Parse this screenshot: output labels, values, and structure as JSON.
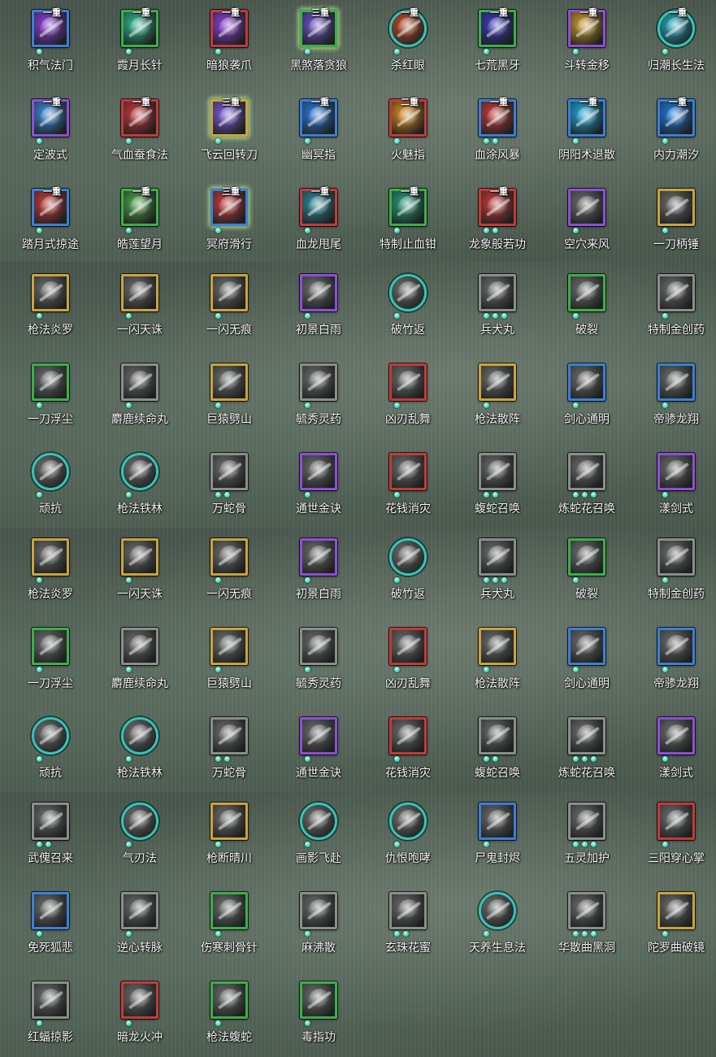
{
  "colors": {
    "purple": "#8e4fd6",
    "green": "#3cae4a",
    "red": "#c33a3a",
    "blue": "#3b7fd8",
    "gold": "#c9a33e",
    "teal": "#33c5b6",
    "gray": "#8a8f8c"
  },
  "rows": [
    [
      {
        "label": "积气法门",
        "badge": "一重",
        "frame": "#3b7fd8",
        "art": "#8a3fd8",
        "dots": 1,
        "icon": "skill-icon"
      },
      {
        "label": "霞月长针",
        "badge": "一重",
        "frame": "#3cae4a",
        "art": "#2fb58e",
        "dots": 1,
        "icon": "skill-icon"
      },
      {
        "label": "暗狼袭爪",
        "badge": "一重",
        "frame": "#c33a3a",
        "art": "#8a3fd8",
        "dots": 1,
        "icon": "skill-icon"
      },
      {
        "label": "黑煞落贪狼",
        "badge": "三重",
        "frame": "#3cae4a",
        "art": "#6a4fc8",
        "dots": 1,
        "glow": true,
        "icon": "skill-icon"
      },
      {
        "label": "杀红眼",
        "badge": "一重",
        "frame": "#33c5b6",
        "art": "#b84a2a",
        "dots": 1,
        "round": true,
        "icon": "skill-icon"
      },
      {
        "label": "七荒黑牙",
        "badge": "一重",
        "frame": "#3cae4a",
        "art": "#3a3ab8",
        "dots": 1,
        "icon": "skill-icon"
      },
      {
        "label": "斗转金移",
        "badge": "一重",
        "frame": "#8e4fd6",
        "art": "#c99a2e",
        "dots": 1,
        "icon": "skill-icon"
      },
      {
        "label": "归潮长生法",
        "badge": "一重",
        "frame": "#33c5b6",
        "art": "#1fa6b8",
        "dots": 1,
        "round": true,
        "icon": "skill-icon"
      }
    ],
    [
      {
        "label": "定波式",
        "badge": "一重",
        "frame": "#8e4fd6",
        "art": "#3a8ad8",
        "dots": 1,
        "icon": "skill-icon"
      },
      {
        "label": "气血蚕食法",
        "badge": "一重",
        "frame": "#c33a3a",
        "art": "#c33a3a",
        "dots": 1,
        "icon": "skill-icon"
      },
      {
        "label": "飞云回转刀",
        "badge": "三重",
        "frame": "#c9a33e",
        "art": "#7a5ad8",
        "dots": 1,
        "glow": true,
        "icon": "skill-icon"
      },
      {
        "label": "幽冥指",
        "badge": "一重",
        "frame": "#3b7fd8",
        "art": "#2a7ad8",
        "dots": 1,
        "icon": "skill-icon"
      },
      {
        "label": "火魅指",
        "badge": "二重",
        "frame": "#c33a3a",
        "art": "#d88a1e",
        "dots": 1,
        "icon": "skill-icon"
      },
      {
        "label": "血涂风暴",
        "badge": "一重",
        "frame": "#3b7fd8",
        "art": "#c33a3a",
        "dots": 2,
        "icon": "skill-icon"
      },
      {
        "label": "阴阳术退散",
        "badge": "一重",
        "frame": "#3b7fd8",
        "art": "#1fa6d8",
        "dots": 1,
        "icon": "skill-icon"
      },
      {
        "label": "内力潮汐",
        "badge": "一重",
        "frame": "#3b7fd8",
        "art": "#1f7ad8",
        "dots": 1,
        "icon": "skill-icon"
      }
    ],
    [
      {
        "label": "踏月式掠途",
        "badge": "一重",
        "frame": "#3b7fd8",
        "art": "#c33a3a",
        "dots": 1,
        "icon": "skill-icon"
      },
      {
        "label": "皓莲望月",
        "badge": "一重",
        "frame": "#3cae4a",
        "art": "#4aa04a",
        "dots": 1,
        "icon": "skill-icon"
      },
      {
        "label": "冥府滑行",
        "badge": "三重",
        "frame": "#3b7fd8",
        "art": "#c33a3a",
        "dots": 1,
        "glow": true,
        "icon": "skill-icon"
      },
      {
        "label": "血龙甩尾",
        "badge": "一重",
        "frame": "#c33a3a",
        "art": "#2a8a9a",
        "dots": 1,
        "icon": "skill-icon"
      },
      {
        "label": "特制止血钳",
        "badge": "一重",
        "frame": "#3cae4a",
        "art": "#2a9a7a",
        "dots": 1,
        "icon": "skill-icon"
      },
      {
        "label": "龙象般若功",
        "badge": "一重",
        "frame": "#c33a3a",
        "art": "#c33a3a",
        "dots": 2,
        "icon": "skill-icon"
      },
      {
        "label": "空穴来风",
        "badge": "",
        "frame": "#8e4fd6",
        "art": "#6a6d6b",
        "dots": 1,
        "icon": "skill-icon"
      },
      {
        "label": "一刀柄锤",
        "badge": "",
        "frame": "#c9a33e",
        "art": "#6a6d6b",
        "dots": 1,
        "icon": "skill-icon"
      }
    ],
    [
      {
        "label": "枪法炎罗",
        "badge": "",
        "frame": "#c9a33e",
        "art": "#6a6d6b",
        "dots": 1,
        "icon": "skill-icon"
      },
      {
        "label": "一闪天诛",
        "badge": "",
        "frame": "#c9a33e",
        "art": "#6a6d6b",
        "dots": 1,
        "icon": "skill-icon"
      },
      {
        "label": "一闪无痕",
        "badge": "",
        "frame": "#c9a33e",
        "art": "#6a6d6b",
        "dots": 1,
        "icon": "skill-icon"
      },
      {
        "label": "初景白雨",
        "badge": "",
        "frame": "#8e4fd6",
        "art": "#6a6d6b",
        "dots": 1,
        "icon": "skill-icon"
      },
      {
        "label": "破竹返",
        "badge": "",
        "frame": "#33c5b6",
        "art": "#6a6d6b",
        "dots": 1,
        "round": true,
        "icon": "skill-icon"
      },
      {
        "label": "兵犬丸",
        "badge": "",
        "frame": "#8a8f8c",
        "art": "#6a6d6b",
        "dots": 3,
        "icon": "skill-icon"
      },
      {
        "label": "破裂",
        "badge": "",
        "frame": "#3cae4a",
        "art": "#6a6d6b",
        "dots": 1,
        "icon": "skill-icon"
      },
      {
        "label": "特制金创药",
        "badge": "",
        "frame": "#8a8f8c",
        "art": "#6a6d6b",
        "dots": 1,
        "icon": "skill-icon"
      }
    ],
    [
      {
        "label": "一刀浮尘",
        "badge": "",
        "frame": "#3cae4a",
        "art": "#6a6d6b",
        "dots": 1,
        "icon": "skill-icon"
      },
      {
        "label": "麝鹿续命丸",
        "badge": "",
        "frame": "#8a8f8c",
        "art": "#6a6d6b",
        "dots": 1,
        "icon": "skill-icon"
      },
      {
        "label": "巨猿劈山",
        "badge": "",
        "frame": "#c9a33e",
        "art": "#6a6d6b",
        "dots": 1,
        "icon": "skill-icon"
      },
      {
        "label": "毓秀灵药",
        "badge": "",
        "frame": "#8a8f8c",
        "art": "#6a6d6b",
        "dots": 1,
        "icon": "skill-icon"
      },
      {
        "label": "凶刃乱舞",
        "badge": "",
        "frame": "#c33a3a",
        "art": "#6a6d6b",
        "dots": 1,
        "icon": "skill-icon"
      },
      {
        "label": "枪法散阵",
        "badge": "",
        "frame": "#c9a33e",
        "art": "#6a6d6b",
        "dots": 1,
        "icon": "skill-icon"
      },
      {
        "label": "剑心通明",
        "badge": "",
        "frame": "#3b7fd8",
        "art": "#6a6d6b",
        "dots": 1,
        "icon": "skill-icon"
      },
      {
        "label": "帝骖龙翔",
        "badge": "",
        "frame": "#3b7fd8",
        "art": "#6a6d6b",
        "dots": 1,
        "icon": "skill-icon"
      }
    ],
    [
      {
        "label": "顽抗",
        "badge": "",
        "frame": "#33c5b6",
        "art": "#6a6d6b",
        "dots": 1,
        "round": true,
        "icon": "skill-icon"
      },
      {
        "label": "枪法铁林",
        "badge": "",
        "frame": "#33c5b6",
        "art": "#6a6d6b",
        "dots": 1,
        "round": true,
        "icon": "skill-icon"
      },
      {
        "label": "万蛇骨",
        "badge": "",
        "frame": "#8a8f8c",
        "art": "#6a6d6b",
        "dots": 2,
        "icon": "skill-icon"
      },
      {
        "label": "通世金诀",
        "badge": "",
        "frame": "#8e4fd6",
        "art": "#6a6d6b",
        "dots": 1,
        "icon": "skill-icon"
      },
      {
        "label": "花钱消灾",
        "badge": "",
        "frame": "#c33a3a",
        "art": "#6a6d6b",
        "dots": 1,
        "icon": "skill-icon"
      },
      {
        "label": "蝮蛇召唤",
        "badge": "",
        "frame": "#8a8f8c",
        "art": "#6a6d6b",
        "dots": 2,
        "icon": "skill-icon"
      },
      {
        "label": "炼蛇花召唤",
        "badge": "",
        "frame": "#8a8f8c",
        "art": "#6a6d6b",
        "dots": 3,
        "icon": "skill-icon"
      },
      {
        "label": "漾剑式",
        "badge": "",
        "frame": "#8e4fd6",
        "art": "#6a6d6b",
        "dots": 1,
        "icon": "skill-icon"
      }
    ],
    [
      {
        "label": "枪法炎罗",
        "badge": "",
        "frame": "#c9a33e",
        "art": "#6a6d6b",
        "dots": 1,
        "icon": "skill-icon"
      },
      {
        "label": "一闪天诛",
        "badge": "",
        "frame": "#c9a33e",
        "art": "#6a6d6b",
        "dots": 1,
        "icon": "skill-icon"
      },
      {
        "label": "一闪无痕",
        "badge": "",
        "frame": "#c9a33e",
        "art": "#6a6d6b",
        "dots": 1,
        "icon": "skill-icon"
      },
      {
        "label": "初景白雨",
        "badge": "",
        "frame": "#8e4fd6",
        "art": "#6a6d6b",
        "dots": 1,
        "icon": "skill-icon"
      },
      {
        "label": "破竹返",
        "badge": "",
        "frame": "#33c5b6",
        "art": "#6a6d6b",
        "dots": 1,
        "round": true,
        "icon": "skill-icon"
      },
      {
        "label": "兵犬丸",
        "badge": "",
        "frame": "#8a8f8c",
        "art": "#6a6d6b",
        "dots": 3,
        "icon": "skill-icon"
      },
      {
        "label": "破裂",
        "badge": "",
        "frame": "#3cae4a",
        "art": "#6a6d6b",
        "dots": 1,
        "icon": "skill-icon"
      },
      {
        "label": "特制金创药",
        "badge": "",
        "frame": "#8a8f8c",
        "art": "#6a6d6b",
        "dots": 1,
        "icon": "skill-icon"
      }
    ],
    [
      {
        "label": "一刀浮尘",
        "badge": "",
        "frame": "#3cae4a",
        "art": "#6a6d6b",
        "dots": 1,
        "icon": "skill-icon"
      },
      {
        "label": "麝鹿续命丸",
        "badge": "",
        "frame": "#8a8f8c",
        "art": "#6a6d6b",
        "dots": 1,
        "icon": "skill-icon"
      },
      {
        "label": "巨猿劈山",
        "badge": "",
        "frame": "#c9a33e",
        "art": "#6a6d6b",
        "dots": 1,
        "icon": "skill-icon"
      },
      {
        "label": "毓秀灵药",
        "badge": "",
        "frame": "#8a8f8c",
        "art": "#6a6d6b",
        "dots": 1,
        "icon": "skill-icon"
      },
      {
        "label": "凶刃乱舞",
        "badge": "",
        "frame": "#c33a3a",
        "art": "#6a6d6b",
        "dots": 1,
        "icon": "skill-icon"
      },
      {
        "label": "枪法散阵",
        "badge": "",
        "frame": "#c9a33e",
        "art": "#6a6d6b",
        "dots": 1,
        "icon": "skill-icon"
      },
      {
        "label": "剑心通明",
        "badge": "",
        "frame": "#3b7fd8",
        "art": "#6a6d6b",
        "dots": 1,
        "icon": "skill-icon"
      },
      {
        "label": "帝骖龙翔",
        "badge": "",
        "frame": "#3b7fd8",
        "art": "#6a6d6b",
        "dots": 1,
        "icon": "skill-icon"
      }
    ],
    [
      {
        "label": "顽抗",
        "badge": "",
        "frame": "#33c5b6",
        "art": "#6a6d6b",
        "dots": 1,
        "round": true,
        "icon": "skill-icon"
      },
      {
        "label": "枪法铁林",
        "badge": "",
        "frame": "#33c5b6",
        "art": "#6a6d6b",
        "dots": 1,
        "round": true,
        "icon": "skill-icon"
      },
      {
        "label": "万蛇骨",
        "badge": "",
        "frame": "#8a8f8c",
        "art": "#6a6d6b",
        "dots": 2,
        "icon": "skill-icon"
      },
      {
        "label": "通世金诀",
        "badge": "",
        "frame": "#8e4fd6",
        "art": "#6a6d6b",
        "dots": 1,
        "icon": "skill-icon"
      },
      {
        "label": "花钱消灾",
        "badge": "",
        "frame": "#c33a3a",
        "art": "#6a6d6b",
        "dots": 1,
        "icon": "skill-icon"
      },
      {
        "label": "蝮蛇召唤",
        "badge": "",
        "frame": "#8a8f8c",
        "art": "#6a6d6b",
        "dots": 2,
        "icon": "skill-icon"
      },
      {
        "label": "炼蛇花召唤",
        "badge": "",
        "frame": "#8a8f8c",
        "art": "#6a6d6b",
        "dots": 3,
        "icon": "skill-icon"
      },
      {
        "label": "漾剑式",
        "badge": "",
        "frame": "#8e4fd6",
        "art": "#6a6d6b",
        "dots": 1,
        "icon": "skill-icon"
      }
    ],
    [
      {
        "label": "武傀召来",
        "badge": "",
        "frame": "#8a8f8c",
        "art": "#6a6d6b",
        "dots": 2,
        "icon": "skill-icon"
      },
      {
        "label": "气刃法",
        "badge": "",
        "frame": "#33c5b6",
        "art": "#6a6d6b",
        "dots": 1,
        "round": true,
        "icon": "skill-icon"
      },
      {
        "label": "枪断晴川",
        "badge": "",
        "frame": "#c9a33e",
        "art": "#6a6d6b",
        "dots": 1,
        "icon": "skill-icon"
      },
      {
        "label": "画影飞赴",
        "badge": "",
        "frame": "#33c5b6",
        "art": "#6a6d6b",
        "dots": 1,
        "round": true,
        "icon": "skill-icon"
      },
      {
        "label": "仇恨咆哮",
        "badge": "",
        "frame": "#33c5b6",
        "art": "#6a6d6b",
        "dots": 1,
        "round": true,
        "icon": "skill-icon"
      },
      {
        "label": "尸鬼封烬",
        "badge": "",
        "frame": "#3b7fd8",
        "art": "#6a6d6b",
        "dots": 1,
        "icon": "skill-icon"
      },
      {
        "label": "五灵加护",
        "badge": "",
        "frame": "#8a8f8c",
        "art": "#6a6d6b",
        "dots": 3,
        "icon": "skill-icon"
      },
      {
        "label": "三阳穿心掌",
        "badge": "",
        "frame": "#c33a3a",
        "art": "#6a6d6b",
        "dots": 1,
        "icon": "skill-icon"
      }
    ],
    [
      {
        "label": "免死狐悲",
        "badge": "",
        "frame": "#3b7fd8",
        "art": "#6a6d6b",
        "dots": 1,
        "icon": "skill-icon"
      },
      {
        "label": "逆心转脉",
        "badge": "",
        "frame": "#8a8f8c",
        "art": "#6a6d6b",
        "dots": 1,
        "icon": "skill-icon"
      },
      {
        "label": "伤寒刺骨针",
        "badge": "",
        "frame": "#3cae4a",
        "art": "#6a6d6b",
        "dots": 1,
        "icon": "skill-icon"
      },
      {
        "label": "麻沸散",
        "badge": "",
        "frame": "#8a8f8c",
        "art": "#6a6d6b",
        "dots": 1,
        "icon": "skill-icon"
      },
      {
        "label": "玄珠花蜜",
        "badge": "",
        "frame": "#8a8f8c",
        "art": "#6a6d6b",
        "dots": 2,
        "icon": "skill-icon"
      },
      {
        "label": "天养生息法",
        "badge": "",
        "frame": "#33c5b6",
        "art": "#6a6d6b",
        "dots": 1,
        "round": true,
        "icon": "skill-icon"
      },
      {
        "label": "华散曲黑洞",
        "badge": "",
        "frame": "#8a8f8c",
        "art": "#6a6d6b",
        "dots": 3,
        "icon": "skill-icon"
      },
      {
        "label": "陀罗曲破镜",
        "badge": "",
        "frame": "#c9a33e",
        "art": "#6a6d6b",
        "dots": 1,
        "icon": "skill-icon"
      }
    ],
    [
      {
        "label": "红蝠掠影",
        "badge": "",
        "frame": "#8a8f8c",
        "art": "#6a6d6b",
        "dots": 1,
        "icon": "skill-icon"
      },
      {
        "label": "暗龙火冲",
        "badge": "",
        "frame": "#c33a3a",
        "art": "#6a6d6b",
        "dots": 1,
        "icon": "skill-icon"
      },
      {
        "label": "枪法蝮蛇",
        "badge": "",
        "frame": "#3cae4a",
        "art": "#6a6d6b",
        "dots": 1,
        "icon": "skill-icon"
      },
      {
        "label": "毒指功",
        "badge": "",
        "frame": "#3cae4a",
        "art": "#6a6d6b",
        "dots": 1,
        "icon": "skill-icon"
      }
    ]
  ]
}
